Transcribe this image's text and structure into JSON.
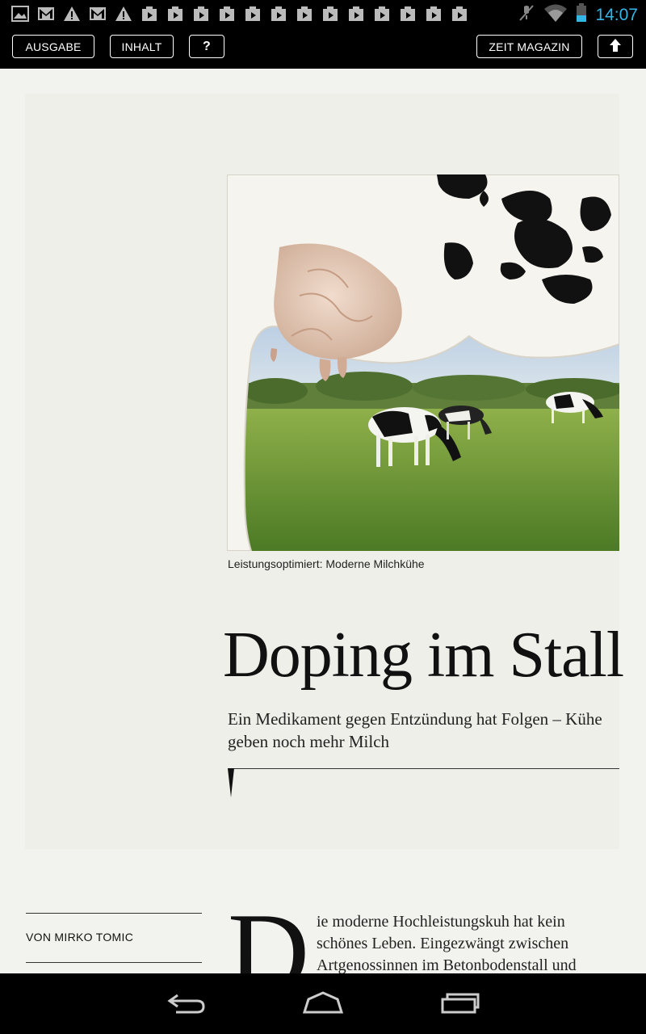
{
  "status_bar": {
    "clock": "14:07",
    "notification_icons": [
      "gallery-icon",
      "gmail-icon",
      "warning-icon",
      "gmail-icon",
      "warning-icon",
      "play-store-icon",
      "play-store-icon",
      "play-store-icon",
      "play-store-icon",
      "play-store-icon",
      "play-store-icon",
      "play-store-icon",
      "play-store-icon",
      "play-store-icon",
      "play-store-icon",
      "play-store-icon",
      "play-store-icon",
      "play-store-icon"
    ],
    "accent_color": "#33b5e5"
  },
  "toolbar": {
    "ausgabe_label": "AUSGABE",
    "inhalt_label": "INHALT",
    "help_label": "?",
    "magazin_label": "ZEIT MAGAZIN",
    "up_icon": "arrow-up-icon"
  },
  "article": {
    "caption": "Leistungsoptimiert: Moderne Milchkühe",
    "headline": "Doping im Stall",
    "subtitle": "Ein Medikament gegen Entzündung hat Folgen – Kühe geben noch mehr Milch",
    "author": "VON MIRKO TOMIC",
    "drop_cap": "D",
    "body": "ie moderne Hochleistungskuh hat kein schönes Leben. Eingezwängt zwischen Artgenossinnen im Betonbodenstall und"
  },
  "nav_bar": {
    "icons": [
      "back-icon",
      "home-icon",
      "recent-apps-icon"
    ]
  }
}
